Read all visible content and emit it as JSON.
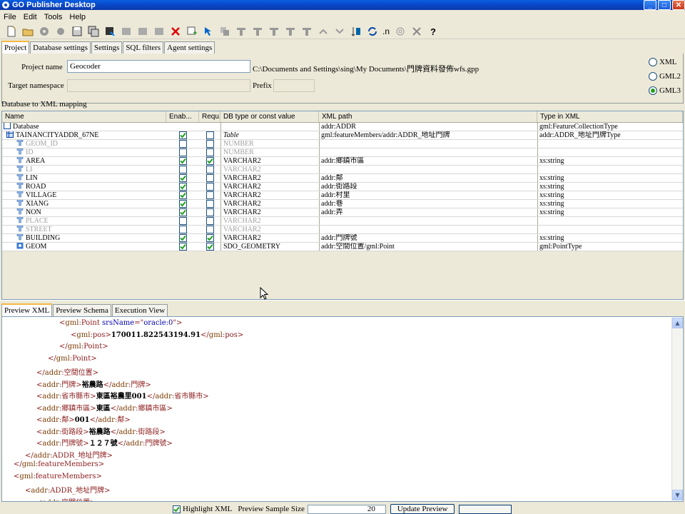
{
  "window": {
    "title": "GO Publisher Desktop"
  },
  "menu": [
    "File",
    "Edit",
    "Tools",
    "Help"
  ],
  "toolbar": {
    "text_n": ".n"
  },
  "top_tabs": [
    "Project",
    "Database settings",
    "Settings",
    "SQL filters",
    "Agent settings"
  ],
  "project": {
    "name_label": "Project name",
    "name_value": "Geocoder",
    "path": "C:\\Documents and Settings\\sing\\My Documents\\門牌資料發佈wfs.gpp",
    "ns_label": "Target namespace",
    "prefix_label": "Prefix",
    "formats": [
      "XML",
      "GML2",
      "GML3"
    ],
    "selected_format": "GML3"
  },
  "mapping": {
    "title": "Database to XML mapping",
    "headers": [
      "Name",
      "Enab...",
      "Requ...",
      "DB type or const value",
      "XML path",
      "Type in XML"
    ],
    "rows": [
      {
        "name": "Database",
        "indent": 0,
        "icon": "database",
        "en": null,
        "req": null,
        "db": "",
        "xml": "addr:ADDR",
        "type": "gml:FeatureCollectionType",
        "dim": false
      },
      {
        "name": "TAINANCITYADDR_67NE",
        "indent": 1,
        "icon": "table",
        "en": true,
        "req": false,
        "db": "Table",
        "xml": "gml:featureMembers/addr:ADDR_地址門牌",
        "type": "addr:ADDR_地址門牌Type",
        "dim": false
      },
      {
        "name": "GEOM_ID",
        "indent": 2,
        "icon": "column",
        "en": false,
        "req": false,
        "db": "NUMBER",
        "xml": "",
        "type": "",
        "dim": true
      },
      {
        "name": "ID",
        "indent": 2,
        "icon": "column",
        "en": false,
        "req": false,
        "db": "NUMBER",
        "xml": "",
        "type": "",
        "dim": true
      },
      {
        "name": "AREA",
        "indent": 2,
        "icon": "column",
        "en": true,
        "req": true,
        "db": "VARCHAR2",
        "xml": "addr:鄉鎮市區",
        "type": "xs:string",
        "dim": false
      },
      {
        "name": "LI",
        "indent": 2,
        "icon": "column",
        "en": false,
        "req": false,
        "db": "VARCHAR2",
        "xml": "",
        "type": "",
        "dim": true
      },
      {
        "name": "LIN",
        "indent": 2,
        "icon": "column",
        "en": true,
        "req": false,
        "db": "VARCHAR2",
        "xml": "addr:鄰",
        "type": "xs:string",
        "dim": false
      },
      {
        "name": "ROAD",
        "indent": 2,
        "icon": "column",
        "en": true,
        "req": false,
        "db": "VARCHAR2",
        "xml": "addr:街路段",
        "type": "xs:string",
        "dim": false
      },
      {
        "name": "VILLAGE",
        "indent": 2,
        "icon": "column",
        "en": true,
        "req": false,
        "db": "VARCHAR2",
        "xml": "addr:村里",
        "type": "xs:string",
        "dim": false
      },
      {
        "name": "XIANG",
        "indent": 2,
        "icon": "column",
        "en": true,
        "req": false,
        "db": "VARCHAR2",
        "xml": "addr:巷",
        "type": "xs:string",
        "dim": false
      },
      {
        "name": "NON",
        "indent": 2,
        "icon": "column",
        "en": true,
        "req": false,
        "db": "VARCHAR2",
        "xml": "addr:弄",
        "type": "xs:string",
        "dim": false
      },
      {
        "name": "PLACE",
        "indent": 2,
        "icon": "column",
        "en": false,
        "req": false,
        "db": "VARCHAR2",
        "xml": "",
        "type": "",
        "dim": true
      },
      {
        "name": "STREET",
        "indent": 2,
        "icon": "column",
        "en": false,
        "req": false,
        "db": "VARCHAR2",
        "xml": "",
        "type": "",
        "dim": true
      },
      {
        "name": "BUILDING",
        "indent": 2,
        "icon": "column",
        "en": true,
        "req": true,
        "db": "VARCHAR2",
        "xml": "addr:門牌號",
        "type": "xs:string",
        "dim": false
      },
      {
        "name": "GEOM",
        "indent": 2,
        "icon": "geom",
        "en": true,
        "req": true,
        "db": "SDO_GEOMETRY",
        "xml": "addr:空間位置/gml:Point",
        "type": "gml:PointType",
        "dim": false
      }
    ]
  },
  "bottom_tabs": [
    "Preview XML",
    "Preview Schema",
    "Execution View"
  ],
  "xml_lines": [
    {
      "indent": 80,
      "parts": [
        [
          "t",
          "<"
        ],
        [
          "n",
          "gml"
        ],
        [
          "t",
          ":Point "
        ],
        [
          "a",
          "srsName"
        ],
        [
          "t",
          "=\""
        ],
        [
          "v",
          "oracle:0"
        ],
        [
          "t",
          "\">"
        ]
      ]
    },
    {
      "indent": 96,
      "parts": [
        [
          "t",
          "<"
        ],
        [
          "n",
          "gml"
        ],
        [
          "t",
          ":pos>"
        ],
        [
          "b",
          "170011.822543194.91"
        ],
        [
          "t",
          "</"
        ],
        [
          "n",
          "gml"
        ],
        [
          "t",
          ":pos>"
        ]
      ]
    },
    {
      "indent": 80,
      "parts": [
        [
          "t",
          "</"
        ],
        [
          "n",
          "gml"
        ],
        [
          "t",
          ":Point>"
        ]
      ]
    },
    {
      "indent": 64,
      "parts": [
        [
          "t",
          "</"
        ],
        [
          "n",
          "gml"
        ],
        [
          "t",
          ":Point>"
        ]
      ]
    },
    {
      "indent": 48,
      "parts": [
        [
          "t",
          "</"
        ],
        [
          "n",
          "addr"
        ],
        [
          "t",
          ":空間位置>"
        ]
      ]
    },
    {
      "indent": 48,
      "parts": [
        [
          "t",
          "<"
        ],
        [
          "n",
          "addr"
        ],
        [
          "t",
          ":門牌>"
        ],
        [
          "b",
          "裕農路"
        ],
        [
          "t",
          "</"
        ],
        [
          "n",
          "addr"
        ],
        [
          "t",
          ":門牌>"
        ]
      ]
    },
    {
      "indent": 48,
      "parts": [
        [
          "t",
          "<"
        ],
        [
          "n",
          "addr"
        ],
        [
          "t",
          ":省市縣市>"
        ],
        [
          "b",
          "東區裕農里001"
        ],
        [
          "t",
          "</"
        ],
        [
          "n",
          "addr"
        ],
        [
          "t",
          ":省市縣市>"
        ]
      ]
    },
    {
      "indent": 48,
      "parts": [
        [
          "t",
          "<"
        ],
        [
          "n",
          "addr"
        ],
        [
          "t",
          ":鄉鎮市區>"
        ],
        [
          "b",
          "東區"
        ],
        [
          "t",
          "</"
        ],
        [
          "n",
          "addr"
        ],
        [
          "t",
          ":鄉鎮市區>"
        ]
      ]
    },
    {
      "indent": 48,
      "parts": [
        [
          "t",
          "<"
        ],
        [
          "n",
          "addr"
        ],
        [
          "t",
          ":鄰>"
        ],
        [
          "b",
          "001"
        ],
        [
          "t",
          "</"
        ],
        [
          "n",
          "addr"
        ],
        [
          "t",
          ":鄰>"
        ]
      ]
    },
    {
      "indent": 48,
      "parts": [
        [
          "t",
          "<"
        ],
        [
          "n",
          "addr"
        ],
        [
          "t",
          ":街路段>"
        ],
        [
          "b",
          "裕農路"
        ],
        [
          "t",
          "</"
        ],
        [
          "n",
          "addr"
        ],
        [
          "t",
          ":街路段>"
        ]
      ]
    },
    {
      "indent": 48,
      "parts": [
        [
          "t",
          "<"
        ],
        [
          "n",
          "addr"
        ],
        [
          "t",
          ":門牌號>"
        ],
        [
          "b",
          "１２７號"
        ],
        [
          "t",
          "</"
        ],
        [
          "n",
          "addr"
        ],
        [
          "t",
          ":門牌號>"
        ]
      ]
    },
    {
      "indent": 32,
      "parts": [
        [
          "t",
          "</"
        ],
        [
          "n",
          "addr"
        ],
        [
          "t",
          ":ADDR_地址門牌>"
        ]
      ]
    },
    {
      "indent": 16,
      "parts": [
        [
          "t",
          "</"
        ],
        [
          "n",
          "gml"
        ],
        [
          "t",
          ":featureMembers>"
        ]
      ]
    },
    {
      "indent": 16,
      "parts": [
        [
          "t",
          "<"
        ],
        [
          "n",
          "gml"
        ],
        [
          "t",
          ":featureMembers>"
        ]
      ]
    },
    {
      "indent": 32,
      "parts": [
        [
          "t",
          "<"
        ],
        [
          "n",
          "addr"
        ],
        [
          "t",
          ":ADDR_地址門牌>"
        ]
      ]
    },
    {
      "indent": 48,
      "parts": [
        [
          "t",
          "<"
        ],
        [
          "n",
          "addr"
        ],
        [
          "t",
          ":空間位置>"
        ]
      ]
    }
  ],
  "footer": {
    "highlight_label": "Highlight XML",
    "sample_label": "Preview Sample Size",
    "sample_value": "20",
    "update_label": "Update Preview"
  },
  "colors": {
    "tag": "#8b1a1a",
    "value": "#000000",
    "attr": "#0000b0"
  }
}
